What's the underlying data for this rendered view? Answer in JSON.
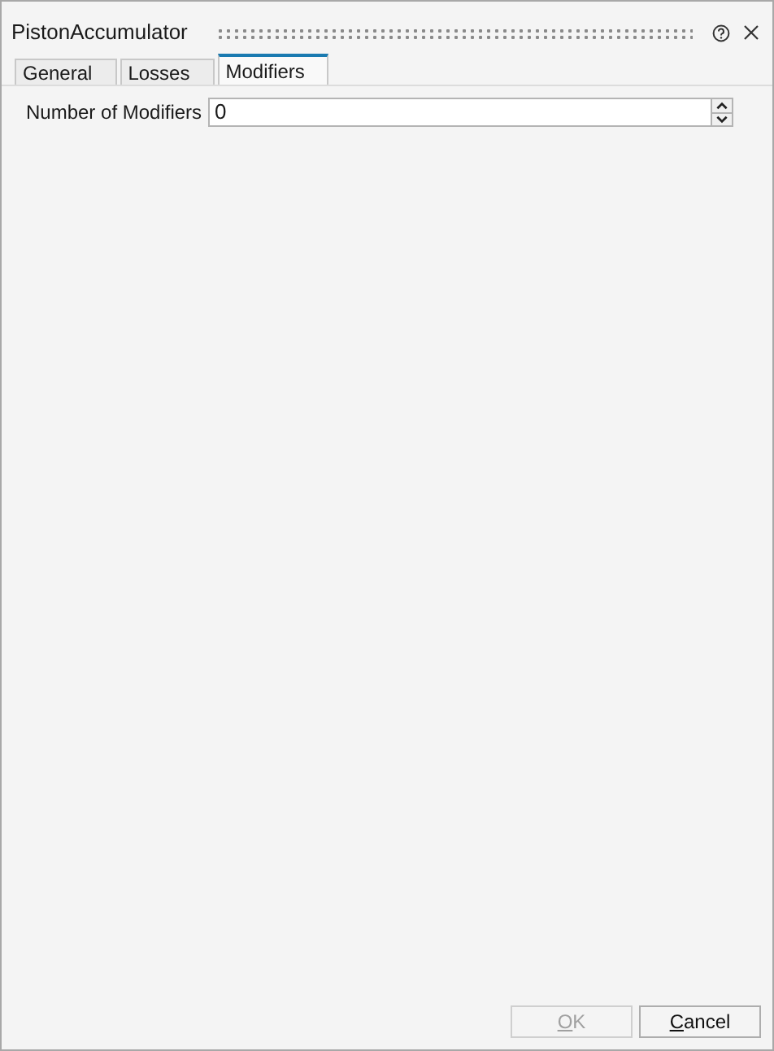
{
  "window": {
    "title": "PistonAccumulator"
  },
  "tabs": [
    {
      "label": "General",
      "selected": false
    },
    {
      "label": "Losses",
      "selected": false
    },
    {
      "label": "Modifiers",
      "selected": true
    }
  ],
  "fields": [
    {
      "label": "Number of Modifiers",
      "value": "0"
    }
  ],
  "buttons": [
    {
      "label": "OK",
      "disabled": true
    },
    {
      "label": "Cancel",
      "disabled": false
    }
  ]
}
